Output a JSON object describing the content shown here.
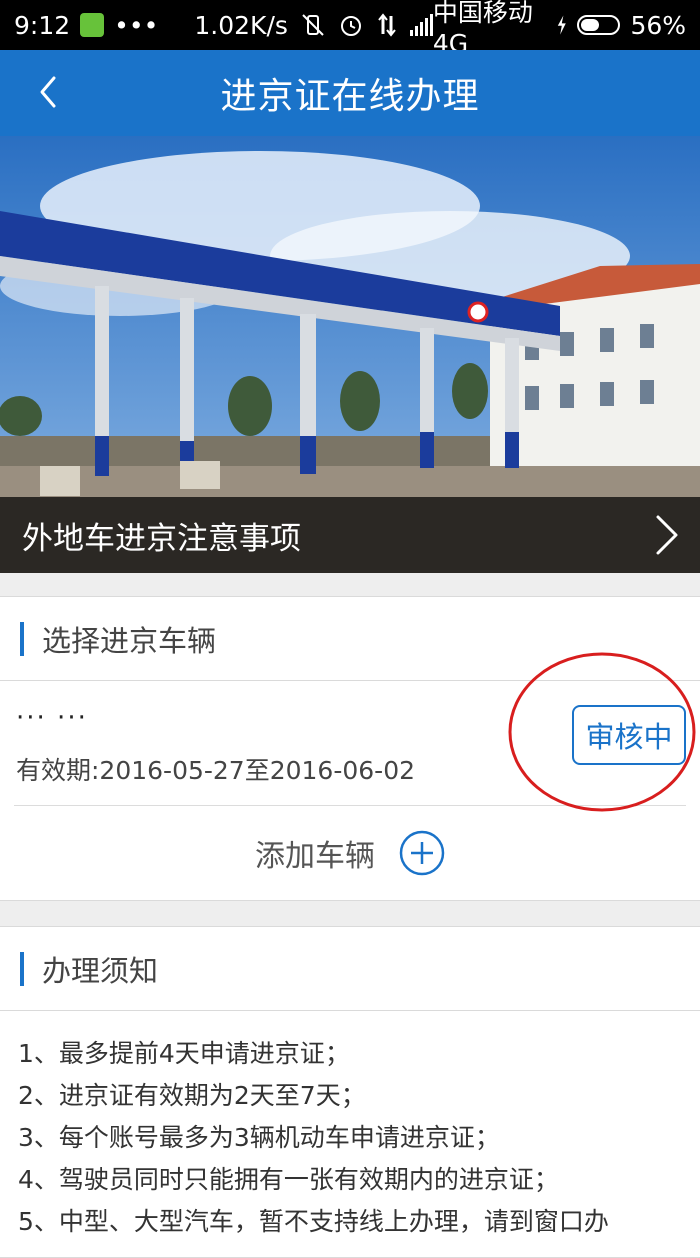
{
  "status_bar": {
    "time": "9:12",
    "dots": "•••",
    "speed": "1.02K/s",
    "carrier": "中国移动 4G",
    "battery": "56%",
    "battery_level": 0.56,
    "icons": [
      "app-notification-icon",
      "vibrate-off-icon",
      "alarm-icon",
      "data-arrows-icon",
      "signal-icon",
      "charging-icon",
      "battery-icon"
    ]
  },
  "header": {
    "title": "进京证在线办理",
    "back_icon": "chevron-left-icon"
  },
  "banner": {
    "caption": "外地车进京注意事项",
    "chevron_icon": "chevron-right-icon"
  },
  "vehicles": {
    "heading": "选择进京车辆",
    "items": [
      {
        "plate": "··· ···",
        "validity": "有效期:2016-05-27至2016-06-02",
        "status": "审核中"
      }
    ],
    "add_label": "添加车辆",
    "add_icon": "plus-circle-icon"
  },
  "notice": {
    "heading": "办理须知",
    "items": [
      "1、最多提前4天申请进京证；",
      "2、进京证有效期为2天至7天；",
      "3、每个账号最多为3辆机动车申请进京证；",
      "4、驾驶员同时只能拥有一张有效期内的进京证；",
      "5、中型、大型汽车，暂不支持线上办理，请到窗口办"
    ]
  },
  "colors": {
    "accent": "#1a73c9",
    "annotation": "#d81e1e",
    "background": "#eeeeee"
  }
}
